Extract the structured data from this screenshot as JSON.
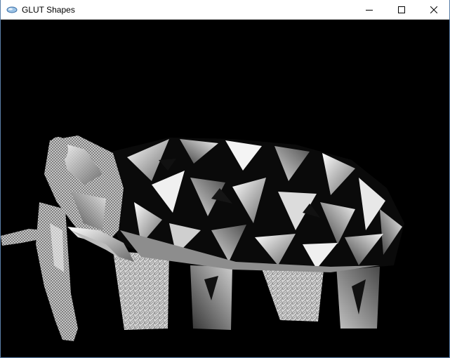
{
  "window": {
    "title": "GLUT Shapes",
    "controls": {
      "minimize_icon": "minimize-icon",
      "maximize_icon": "maximize-icon",
      "close_icon": "close-icon"
    }
  },
  "viewport": {
    "background": "#000000",
    "subject": "elephant-mesh"
  }
}
